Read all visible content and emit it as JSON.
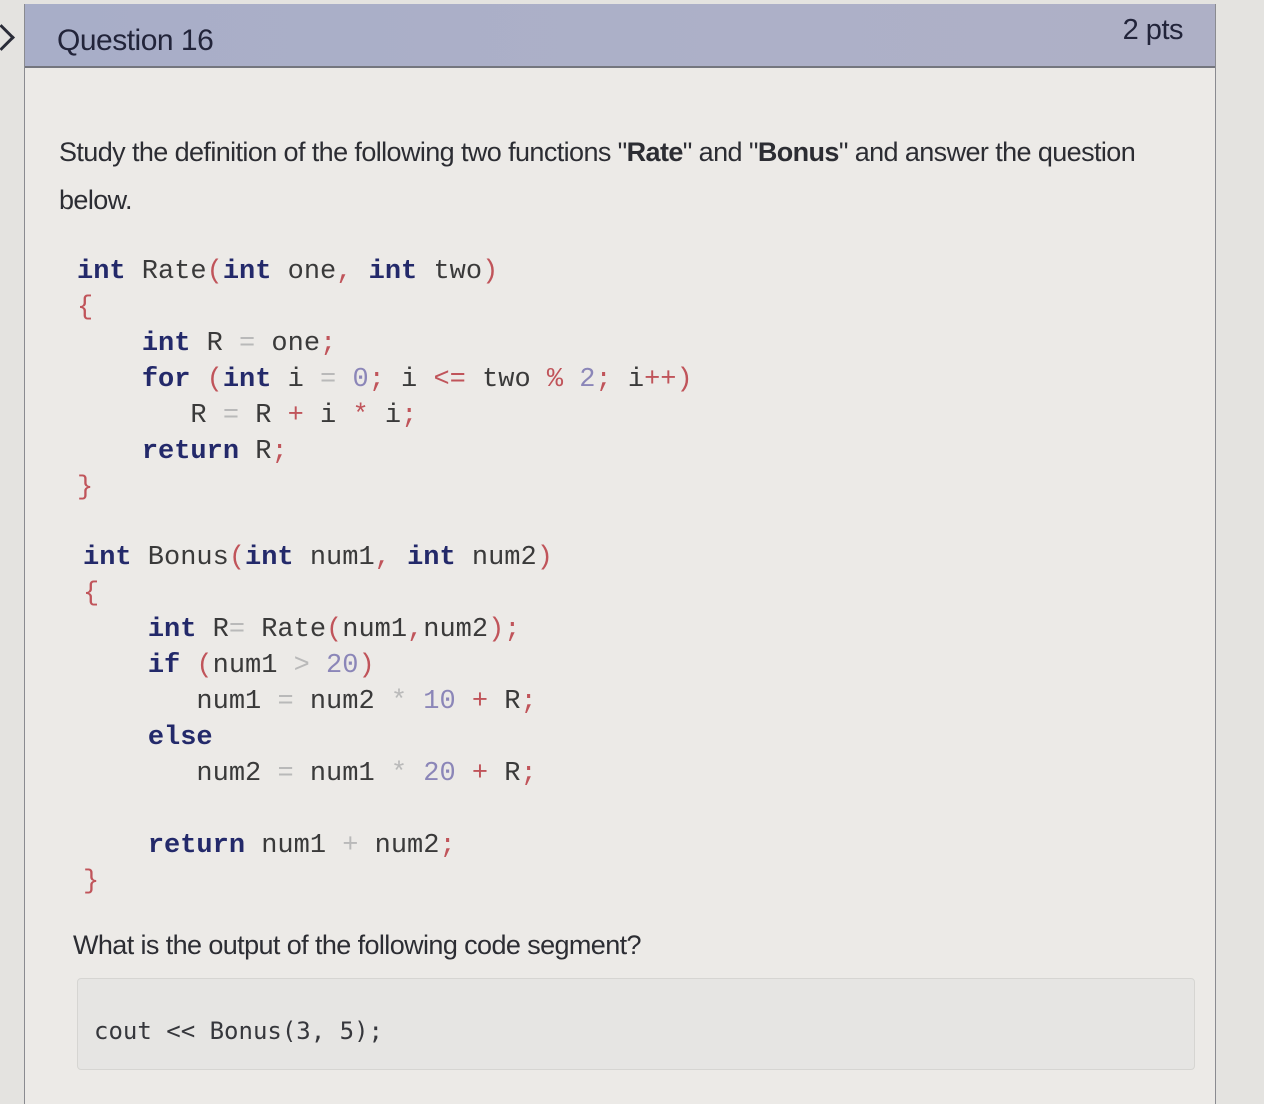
{
  "question": {
    "title": "Question 16",
    "points": "2 pts",
    "intro": {
      "before": "Study the definition of the following two functions \"",
      "fn1": "Rate",
      "mid": "\" and \"",
      "fn2": "Bonus",
      "after": "\" and answer the question below."
    },
    "prompt": "What is the output of the following code segment?",
    "snippet": "cout << Bonus(3, 5);"
  },
  "rate_function": {
    "lines": [
      [
        [
          "kw",
          "int"
        ],
        [
          "tx",
          " Rate"
        ],
        [
          "pn",
          "("
        ],
        [
          "kw",
          "int"
        ],
        [
          "tx",
          " one"
        ],
        [
          "pn",
          ","
        ],
        [
          "tx",
          " "
        ],
        [
          "kw",
          "int"
        ],
        [
          "tx",
          " two"
        ],
        [
          "pn",
          ")"
        ]
      ],
      [
        [
          "pn",
          "{"
        ]
      ],
      [
        [
          "tx",
          "    "
        ],
        [
          "kw",
          "int"
        ],
        [
          "tx",
          " R "
        ],
        [
          "op",
          "="
        ],
        [
          "tx",
          " one"
        ],
        [
          "pn",
          ";"
        ]
      ],
      [
        [
          "tx",
          "    "
        ],
        [
          "kw",
          "for"
        ],
        [
          "tx",
          " "
        ],
        [
          "pn",
          "("
        ],
        [
          "kw",
          "int"
        ],
        [
          "tx",
          " i "
        ],
        [
          "op",
          "="
        ],
        [
          "tx",
          " "
        ],
        [
          "nm",
          "0"
        ],
        [
          "pn",
          ";"
        ],
        [
          "tx",
          " i "
        ],
        [
          "pn",
          "<="
        ],
        [
          "tx",
          " two "
        ],
        [
          "pn",
          "%"
        ],
        [
          "tx",
          " "
        ],
        [
          "nm",
          "2"
        ],
        [
          "pn",
          ";"
        ],
        [
          "tx",
          " i"
        ],
        [
          "pn",
          "++)"
        ]
      ],
      [
        [
          "tx",
          "       R "
        ],
        [
          "op",
          "="
        ],
        [
          "tx",
          " R "
        ],
        [
          "pn",
          "+"
        ],
        [
          "tx",
          " i "
        ],
        [
          "pn",
          "*"
        ],
        [
          "tx",
          " i"
        ],
        [
          "pn",
          ";"
        ]
      ],
      [
        [
          "tx",
          "    "
        ],
        [
          "kw",
          "return"
        ],
        [
          "tx",
          " R"
        ],
        [
          "pn",
          ";"
        ]
      ],
      [
        [
          "pn",
          "}"
        ]
      ]
    ]
  },
  "bonus_function": {
    "lines": [
      [
        [
          "kw",
          "int"
        ],
        [
          "tx",
          " Bonus"
        ],
        [
          "pn",
          "("
        ],
        [
          "kw",
          "int"
        ],
        [
          "tx",
          " num1"
        ],
        [
          "pn",
          ","
        ],
        [
          "tx",
          " "
        ],
        [
          "kw",
          "int"
        ],
        [
          "tx",
          " num2"
        ],
        [
          "pn",
          ")"
        ]
      ],
      [
        [
          "pn",
          "{"
        ]
      ],
      [
        [
          "tx",
          "    "
        ],
        [
          "kw",
          "int"
        ],
        [
          "tx",
          " R"
        ],
        [
          "op",
          "="
        ],
        [
          "tx",
          " Rate"
        ],
        [
          "pn",
          "("
        ],
        [
          "tx",
          "num1"
        ],
        [
          "pn",
          ","
        ],
        [
          "tx",
          "num2"
        ],
        [
          "pn",
          ");"
        ]
      ],
      [
        [
          "tx",
          "    "
        ],
        [
          "kw",
          "if"
        ],
        [
          "tx",
          " "
        ],
        [
          "pn",
          "("
        ],
        [
          "tx",
          "num1 "
        ],
        [
          "op",
          ">"
        ],
        [
          "tx",
          " "
        ],
        [
          "nm",
          "20"
        ],
        [
          "pn",
          ")"
        ]
      ],
      [
        [
          "tx",
          "       num1 "
        ],
        [
          "op",
          "="
        ],
        [
          "tx",
          " num2 "
        ],
        [
          "op",
          "*"
        ],
        [
          "tx",
          " "
        ],
        [
          "nm",
          "10"
        ],
        [
          "tx",
          " "
        ],
        [
          "pn",
          "+"
        ],
        [
          "tx",
          " R"
        ],
        [
          "pn",
          ";"
        ]
      ],
      [
        [
          "tx",
          "    "
        ],
        [
          "kw",
          "else"
        ]
      ],
      [
        [
          "tx",
          "       num2 "
        ],
        [
          "op",
          "="
        ],
        [
          "tx",
          " num1 "
        ],
        [
          "op",
          "*"
        ],
        [
          "tx",
          " "
        ],
        [
          "nm",
          "20"
        ],
        [
          "tx",
          " "
        ],
        [
          "pn",
          "+"
        ],
        [
          "tx",
          " R"
        ],
        [
          "pn",
          ";"
        ]
      ],
      [
        [
          "tx",
          ""
        ]
      ],
      [
        [
          "tx",
          "    "
        ],
        [
          "kw",
          "return"
        ],
        [
          "tx",
          " num1 "
        ],
        [
          "op",
          "+"
        ],
        [
          "tx",
          " num2"
        ],
        [
          "pn",
          ";"
        ]
      ],
      [
        [
          "pn",
          "}"
        ]
      ]
    ]
  }
}
